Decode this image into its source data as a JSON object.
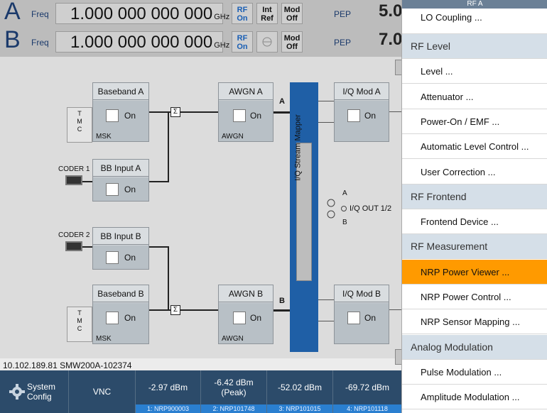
{
  "header": {
    "a": {
      "letter": "A",
      "freq_label": "Freq",
      "freq_value": "1.000 000 000 000",
      "unit": "GHz",
      "rf": "RF On",
      "ref": "Int Ref",
      "mod": "Mod Off",
      "pep_label": "PEP",
      "pep_value": "5.0"
    },
    "b": {
      "letter": "B",
      "freq_label": "Freq",
      "freq_value": "1.000 000 000 000",
      "unit": "GHz",
      "rf": "RF On",
      "mod": "Mod Off",
      "pep_label": "PEP",
      "pep_value": "7.0"
    }
  },
  "diagram": {
    "baseband_a": "Baseband A",
    "baseband_b": "Baseband B",
    "bb_input_a": "BB Input A",
    "bb_input_b": "BB Input B",
    "awgn_a": "AWGN A",
    "awgn_b": "AWGN B",
    "iq_mod_a": "I/Q Mod A",
    "iq_mod_b": "I/Q Mod B",
    "on": "On",
    "msk": "MSK",
    "awgn_sub": "AWGN",
    "tmc": "T\nM\nC",
    "coder1": "CODER 1",
    "coder2": "CODER 2",
    "mapper": "I/Q Stream Mapper",
    "path_a": "A",
    "path_b": "B",
    "iq_out": "I/Q OUT 1/2",
    "out_a": "A",
    "out_b": "B",
    "sum": "Σ"
  },
  "ip_address": "10.102.189.81 SMW200A-102374",
  "bottom_bar": {
    "system_config": "System Config",
    "vnc": "VNC",
    "sensors": [
      {
        "value": "-2.97 dBm",
        "label": "1: NRP900003"
      },
      {
        "value": "-6.42 dBm (Peak)",
        "label": "2: NRP101748"
      },
      {
        "value": "-52.02 dBm",
        "label": "3: NRP101015"
      },
      {
        "value": "-69.72 dBm",
        "label": "4: NRP101118"
      }
    ]
  },
  "menu": {
    "header": "RF A",
    "items": [
      {
        "label": "LO Coupling ...",
        "section": false
      },
      {
        "label": "RF Level",
        "section": true
      },
      {
        "label": "Level ...",
        "section": false
      },
      {
        "label": "Attenuator ...",
        "section": false
      },
      {
        "label": "Power-On / EMF ...",
        "section": false
      },
      {
        "label": "Automatic Level Control ...",
        "section": false
      },
      {
        "label": "User Correction ...",
        "section": false
      },
      {
        "label": "RF Frontend",
        "section": true
      },
      {
        "label": "Frontend Device ...",
        "section": false
      },
      {
        "label": "RF Measurement",
        "section": true
      },
      {
        "label": "NRP Power Viewer ...",
        "section": false,
        "selected": true
      },
      {
        "label": "NRP Power Control ...",
        "section": false
      },
      {
        "label": "NRP Sensor Mapping ...",
        "section": false
      },
      {
        "label": "Analog Modulation",
        "section": true
      },
      {
        "label": "Pulse Modulation ...",
        "section": false
      },
      {
        "label": "Amplitude Modulation ...",
        "section": false
      }
    ]
  },
  "colors": {
    "accent": "#1f5fa6",
    "selected": "#ff9a00",
    "bottom_bar": "#2c4b6a"
  }
}
